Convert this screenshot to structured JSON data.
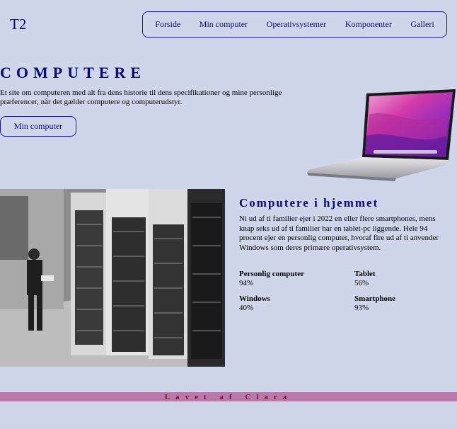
{
  "logo": "T2",
  "nav": {
    "items": [
      "Forside",
      "Min computer",
      "Operativsystemer",
      "Komponenter",
      "Galleri"
    ]
  },
  "hero": {
    "title": "COMPUTERE",
    "text": "Et site om computeren med alt fra dens historie til dens specifikationer og mine personlige præferencer, når det gælder computere og computerudstyr.",
    "button": "Min computer"
  },
  "section": {
    "title": "Computere i hjemmet",
    "text": "Ni ud af ti familier ejer i 2022 en eller flere smartphones, mens knap seks ud af ti familier har en tablet-pc liggende. Hele 94 procent ejer en personlig computer, hvoraf fire ud af ti anvender Windows som deres primære operativsystem.",
    "stats": [
      {
        "label": "Personlig computer",
        "value": "94%"
      },
      {
        "label": "Tablet",
        "value": "56%"
      },
      {
        "label": "Windows",
        "value": "40%"
      },
      {
        "label": "Smartphone",
        "value": "93%"
      }
    ]
  },
  "footer": "Lavet af Clara",
  "colors": {
    "background": "#cfd6ea",
    "accent": "#0a0a7a",
    "footer": "#b87aa8"
  }
}
